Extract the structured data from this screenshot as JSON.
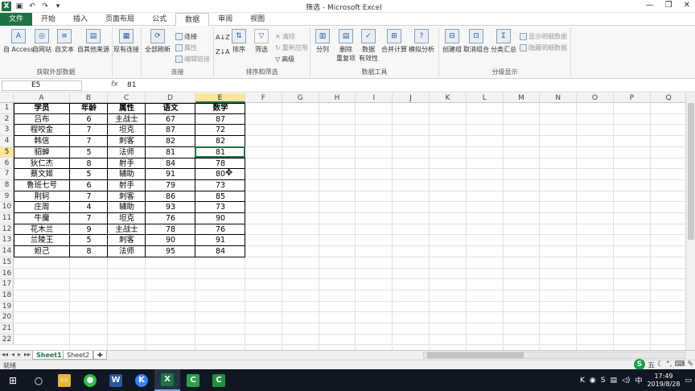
{
  "window": {
    "title": "筛选 - Microsoft Excel",
    "app_icon": "excel-icon"
  },
  "qat": [
    "save-icon",
    "undo-icon",
    "redo-icon",
    "customize-icon"
  ],
  "tabs": [
    {
      "label": "文件",
      "kind": "file"
    },
    {
      "label": "开始"
    },
    {
      "label": "插入"
    },
    {
      "label": "页面布局"
    },
    {
      "label": "公式"
    },
    {
      "label": "数据",
      "active": true
    },
    {
      "label": "审阅"
    },
    {
      "label": "视图"
    }
  ],
  "ribbon": {
    "groups": {
      "external": {
        "label": "获取外部数据",
        "buttons": [
          "自 Access",
          "自网站",
          "自文本",
          "自其他来源",
          "现有连接"
        ]
      },
      "connections": {
        "label": "连接",
        "big": "全部刷新",
        "small": [
          "连接",
          "属性",
          "编辑链接"
        ]
      },
      "sortfilter": {
        "label": "排序和筛选",
        "sort_az": "A↓Z",
        "sort_za": "Z↓A",
        "sort": "排序",
        "filter": "筛选",
        "small": [
          "清除",
          "重新应用",
          "高级"
        ]
      },
      "datatools": {
        "label": "数据工具",
        "buttons": [
          "分列",
          "删除\n重复项",
          "数据\n有效性",
          "合并计算",
          "模拟分析"
        ]
      },
      "outline": {
        "label": "分级显示",
        "buttons": [
          "创建组",
          "取消组合",
          "分类汇总"
        ],
        "small": [
          "显示明细数据",
          "隐藏明细数据"
        ]
      }
    }
  },
  "formula_bar": {
    "name_box": "E5",
    "fx": "fx",
    "value": "81"
  },
  "columns": [
    "A",
    "B",
    "C",
    "D",
    "E",
    "F",
    "G",
    "H",
    "I",
    "J",
    "K",
    "L",
    "M",
    "N",
    "O",
    "P",
    "Q"
  ],
  "selected_column": "E",
  "selected_row": 5,
  "rows": [
    "1",
    "2",
    "3",
    "4",
    "5",
    "6",
    "7",
    "8",
    "9",
    "10",
    "11",
    "12",
    "13",
    "14",
    "15",
    "16",
    "17",
    "18",
    "19",
    "20",
    "21",
    "22"
  ],
  "table": {
    "header": [
      "学员",
      "年龄",
      "属性",
      "语文",
      "数学"
    ],
    "data": [
      [
        "吕布",
        "6",
        "主战士",
        "67",
        "87"
      ],
      [
        "程咬金",
        "7",
        "坦克",
        "87",
        "72"
      ],
      [
        "韩信",
        "7",
        "刺客",
        "82",
        "82"
      ],
      [
        "貂蝉",
        "5",
        "法师",
        "81",
        "81"
      ],
      [
        "狄仁杰",
        "8",
        "射手",
        "84",
        "78"
      ],
      [
        "蔡文姬",
        "5",
        "辅助",
        "91",
        "80"
      ],
      [
        "鲁班七号",
        "6",
        "射手",
        "79",
        "73"
      ],
      [
        "荆轲",
        "7",
        "刺客",
        "86",
        "85"
      ],
      [
        "庄周",
        "4",
        "辅助",
        "93",
        "73"
      ],
      [
        "牛魔",
        "7",
        "坦克",
        "76",
        "90"
      ],
      [
        "花木兰",
        "9",
        "主战士",
        "78",
        "76"
      ],
      [
        "兰陵王",
        "5",
        "刺客",
        "90",
        "91"
      ],
      [
        "妲己",
        "8",
        "法师",
        "95",
        "84"
      ]
    ]
  },
  "sheets": [
    {
      "label": "Sheet1",
      "active": true
    },
    {
      "label": "Sheet2"
    }
  ],
  "status": {
    "ready": "就绪",
    "ime_text": "五"
  },
  "taskbar": {
    "time": "17:49",
    "date": "2019/8/28",
    "apps": [
      "windows-icon",
      "search-icon",
      "file-explorer-icon",
      "wechat-icon",
      "word-icon",
      "k-app-icon",
      "excel-icon",
      "camtasia-icon",
      "terminal-icon"
    ]
  },
  "colors": {
    "excel_green": "#1e7145",
    "header_highlight": "#fde59a",
    "selection_border": "#217346",
    "taskbar": "#101722"
  }
}
